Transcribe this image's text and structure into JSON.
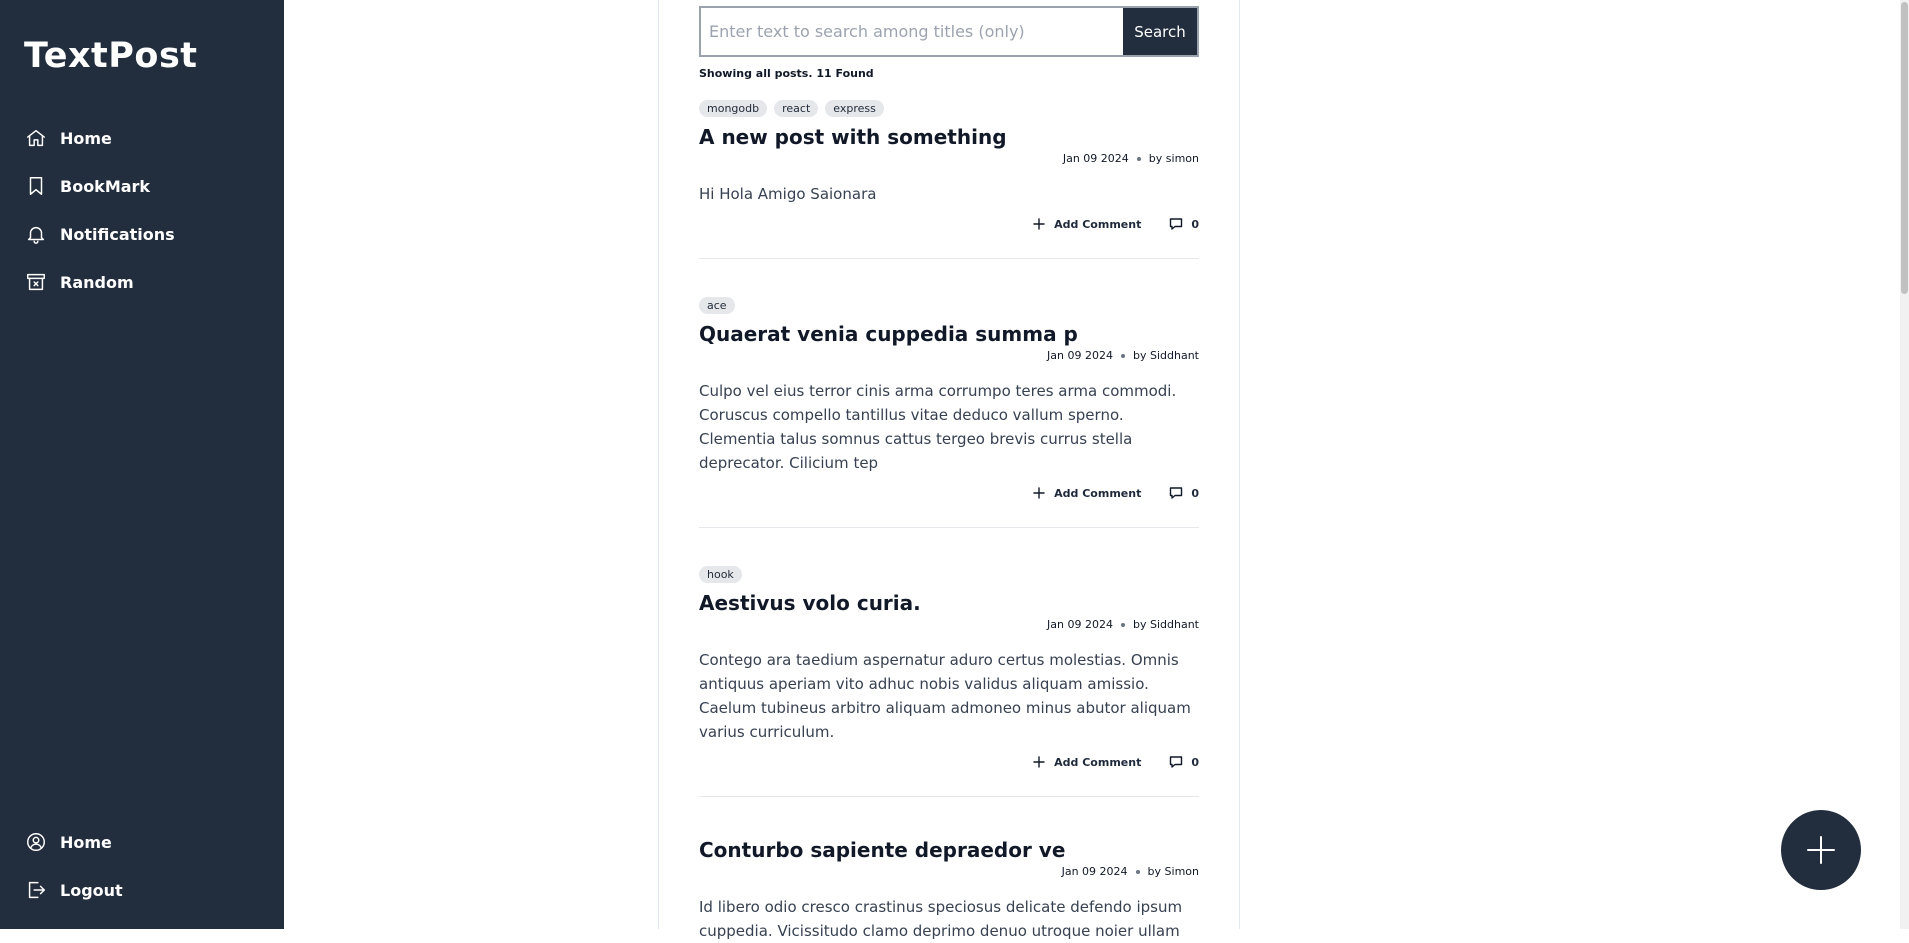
{
  "app": {
    "brand": "TextPost"
  },
  "nav": {
    "home": "Home",
    "bookmark": "BookMark",
    "notifications": "Notifications",
    "random": "Random",
    "profile": "Home",
    "logout": "Logout"
  },
  "search": {
    "placeholder": "Enter text to search among titles (only)",
    "value": "",
    "button": "Search"
  },
  "status_text": "Showing all posts. 11 Found",
  "posts": [
    {
      "tags": [
        "mongodb",
        "react",
        "express"
      ],
      "title": "A new post with something",
      "date": "Jan 09 2024",
      "author": "by simon",
      "body": "Hi Hola Amigo Saionara",
      "add_comment": "Add Comment",
      "comments": "0"
    },
    {
      "tags": [
        "ace"
      ],
      "title": "Quaerat venia cuppedia summa p",
      "date": "Jan 09 2024",
      "author": "by Siddhant",
      "body": "Culpo vel eius terror cinis arma corrumpo teres arma commodi. Coruscus compello tantillus vitae deduco vallum sperno. Clementia talus somnus cattus tergeo brevis currus stella deprecator. Cilicium tep",
      "add_comment": "Add Comment",
      "comments": "0"
    },
    {
      "tags": [
        "hook"
      ],
      "title": "Aestivus volo curia.",
      "date": "Jan 09 2024",
      "author": "by Siddhant",
      "body": "Contego ara taedium aspernatur aduro certus molestias. Omnis antiquus aperiam vito adhuc nobis validus aliquam amissio. Caelum tubineus arbitro aliquam admoneo minus abutor aliquam varius curriculum.",
      "add_comment": "Add Comment",
      "comments": "0"
    },
    {
      "tags": [],
      "title": "Conturbo sapiente depraedor ve",
      "date": "Jan 09 2024",
      "author": "by Simon",
      "body": "Id libero odio cresco crastinus speciosus delicate defendo ipsum cuppedia. Vicissitudo clamo deprimo denuo utroque noier ullam"
    }
  ],
  "icons": {
    "home": "home-icon",
    "bookmark": "bookmark-icon",
    "notifications": "bell-icon",
    "random": "archive-icon",
    "profile": "user-circle-icon",
    "logout": "logout-icon",
    "add_comment": "plus-icon",
    "comment_count": "comment-icon",
    "fab": "plus-icon"
  },
  "colors": {
    "sidebar": "#222d3d",
    "accent": "#222d3d",
    "tag_bg": "#e5e7eb"
  }
}
